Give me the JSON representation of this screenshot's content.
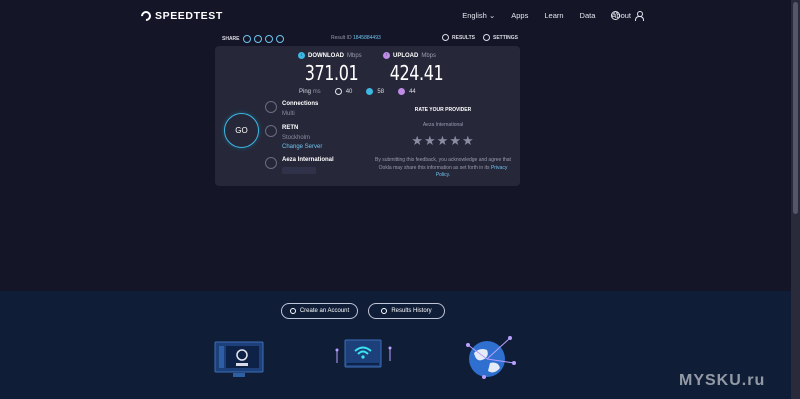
{
  "brand": {
    "name": "SPEEDTEST"
  },
  "nav": {
    "language": "English",
    "links": [
      "Apps",
      "Learn",
      "Data",
      "About"
    ]
  },
  "share": {
    "label": "SHARE",
    "result_id_label": "Result ID",
    "result_id": "1845884493",
    "results_label": "RESULTS",
    "settings_label": "SETTINGS"
  },
  "download": {
    "label": "DOWNLOAD",
    "unit": "Mbps",
    "value": "371.01"
  },
  "upload": {
    "label": "UPLOAD",
    "unit": "Mbps",
    "value": "424.41"
  },
  "ping": {
    "label": "Ping",
    "unit": "ms",
    "idle": "40",
    "down": "58",
    "up": "44"
  },
  "go": {
    "label": "GO"
  },
  "connections": {
    "label": "Connections",
    "value": "Multi"
  },
  "server": {
    "name": "RETN",
    "city": "Stockholm",
    "change": "Change Server"
  },
  "isp": {
    "name": "Aeza International"
  },
  "rate": {
    "title": "RATE YOUR PROVIDER",
    "provider": "Aeza International",
    "stars": "★★★★★",
    "note": "By submitting this feedback, you acknowledge and agree that Ookla may share this information as set forth in its",
    "policy": "Privacy Policy."
  },
  "footer": {
    "create_account": "Create an Account",
    "results_history": "Results History"
  },
  "watermark": "MYSKU.ru",
  "colors": {
    "accent": "#3db8e3",
    "upload": "#c08be6",
    "background": "#141526",
    "panel": "#262839",
    "footer": "#0f1d37"
  }
}
